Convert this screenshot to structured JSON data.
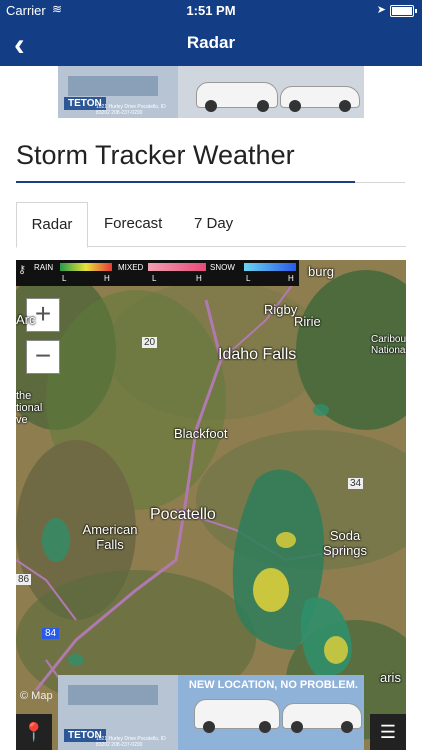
{
  "status_bar": {
    "carrier": "Carrier",
    "time": "1:51 PM",
    "wifi_icon": "wifi-icon",
    "location_icon": "location-arrow-icon",
    "battery_level": 1.0
  },
  "nav": {
    "back_icon": "chevron-left-icon",
    "title": "Radar"
  },
  "ad_top": {
    "dealer": "TETON",
    "address": "1021 Hurley Drive Pocatello, ID 83202 208-237-0200"
  },
  "page_title": "Storm Tracker Weather",
  "tabs": [
    {
      "label": "Radar",
      "active": true
    },
    {
      "label": "Forecast",
      "active": false
    },
    {
      "label": "7 Day",
      "active": false
    }
  ],
  "map": {
    "legend": {
      "key_icon": "key-icon",
      "rain": "RAIN",
      "mixed": "MIXED",
      "snow": "SNOW",
      "low": "L",
      "high": "H"
    },
    "zoom_in": "+",
    "zoom_out": "−",
    "labels": {
      "burg": "burg",
      "rigby": "Rigby",
      "ririe": "Ririe",
      "caribou": "Caribou Nationa",
      "idaho_falls": "Idaho Falls",
      "blackfoot": "Blackfoot",
      "pocatello": "Pocatello",
      "american_falls": "American Falls",
      "soda_springs": "Soda Springs",
      "aris": "aris",
      "arc": "Arc",
      "tional": "the tional ve",
      "hwy_20": "20",
      "hwy_34": "34",
      "hwy_86": "86",
      "hwy_84": "84"
    },
    "attribution": "© Map",
    "location_icon": "map-pin-icon",
    "layers_icon": "layers-icon"
  },
  "ad_bottom": {
    "tagline": "NEW LOCATION, NO PROBLEM.",
    "dealer": "TETON",
    "address": "1021 Hurley Drive Pocatello, ID 83202 208-237-0200"
  },
  "colors": {
    "nav_blue": "#133e86",
    "title_rule": "#1d3d86"
  }
}
